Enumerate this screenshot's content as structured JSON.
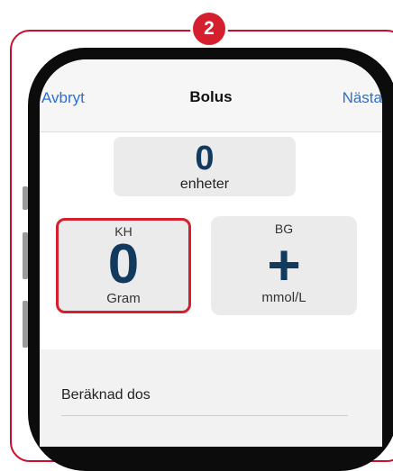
{
  "step_badge": "2",
  "nav": {
    "cancel_label": "Avbryt",
    "title": "Bolus",
    "next_label": "Nästa"
  },
  "units": {
    "value": "0",
    "label": "enheter"
  },
  "kh_tile": {
    "label": "KH",
    "value": "0",
    "unit": "Gram"
  },
  "bg_tile": {
    "label": "BG",
    "value": "+",
    "unit": "mmol/L"
  },
  "calculated_dose_label": "Beräknad dos",
  "colors": {
    "accent_red": "#d4202e",
    "ios_blue": "#2a6fd6",
    "value_navy": "#123a5e"
  }
}
